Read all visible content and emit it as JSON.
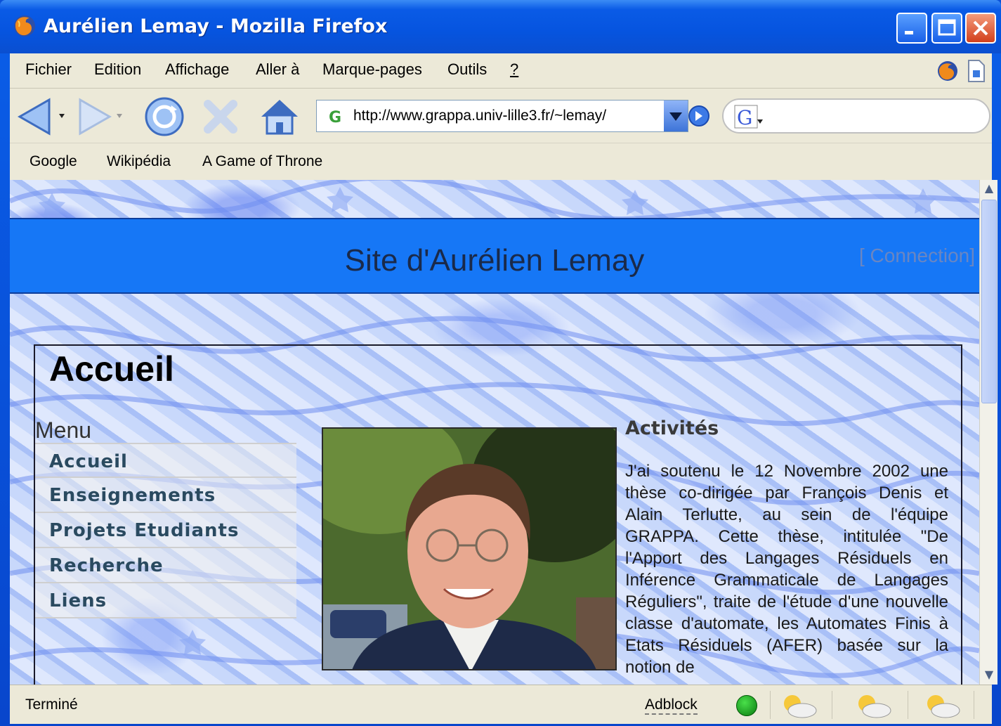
{
  "window": {
    "title": "Aurélien Lemay - Mozilla Firefox"
  },
  "menubar": {
    "items": [
      {
        "label": "Fichier",
        "accel": "F"
      },
      {
        "label": "Edition",
        "accel": "E"
      },
      {
        "label": "Affichage",
        "accel": "A"
      },
      {
        "label": "Aller à",
        "accel": "l"
      },
      {
        "label": "Marque-pages",
        "accel": "M"
      },
      {
        "label": "Outils",
        "accel": "t"
      },
      {
        "label": "?",
        "accel": "?"
      }
    ]
  },
  "navbar": {
    "url": "http://www.grappa.univ-lille3.fr/~lemay/",
    "search_engine_icon": "google-icon"
  },
  "bookmarks": {
    "items": [
      "Google",
      "Wikipédia",
      "A Game of Throne"
    ]
  },
  "page": {
    "site_title": "Site d'Aurélien Lemay",
    "connection_link": "[ Connection]",
    "heading": "Accueil",
    "menu_title": "Menu",
    "menu_links": [
      "Accueil",
      "Enseignements",
      "Projets Etudiants",
      "Recherche",
      "Liens"
    ],
    "activities_title": "Activités",
    "activities_text": "J'ai soutenu le 12 Novembre 2002 une thèse co-dirigée par François Denis et Alain Terlutte, au sein de l'équipe GRAPPA. Cette thèse, intitulée \"De l'Apport des Langages Résiduels en Inférence Grammaticale de Langages Réguliers\", traite de l'étude d'une nouvelle classe d'automate, les Automates Finis à Etats Résiduels (AFER) basée sur la notion de"
  },
  "statusbar": {
    "status": "Terminé",
    "adblock": "Adblock"
  },
  "colors": {
    "titlebar": "#0654df",
    "banner": "#1677f6",
    "menu_link": "#2a4a60",
    "chrome": "#ece9d8"
  }
}
